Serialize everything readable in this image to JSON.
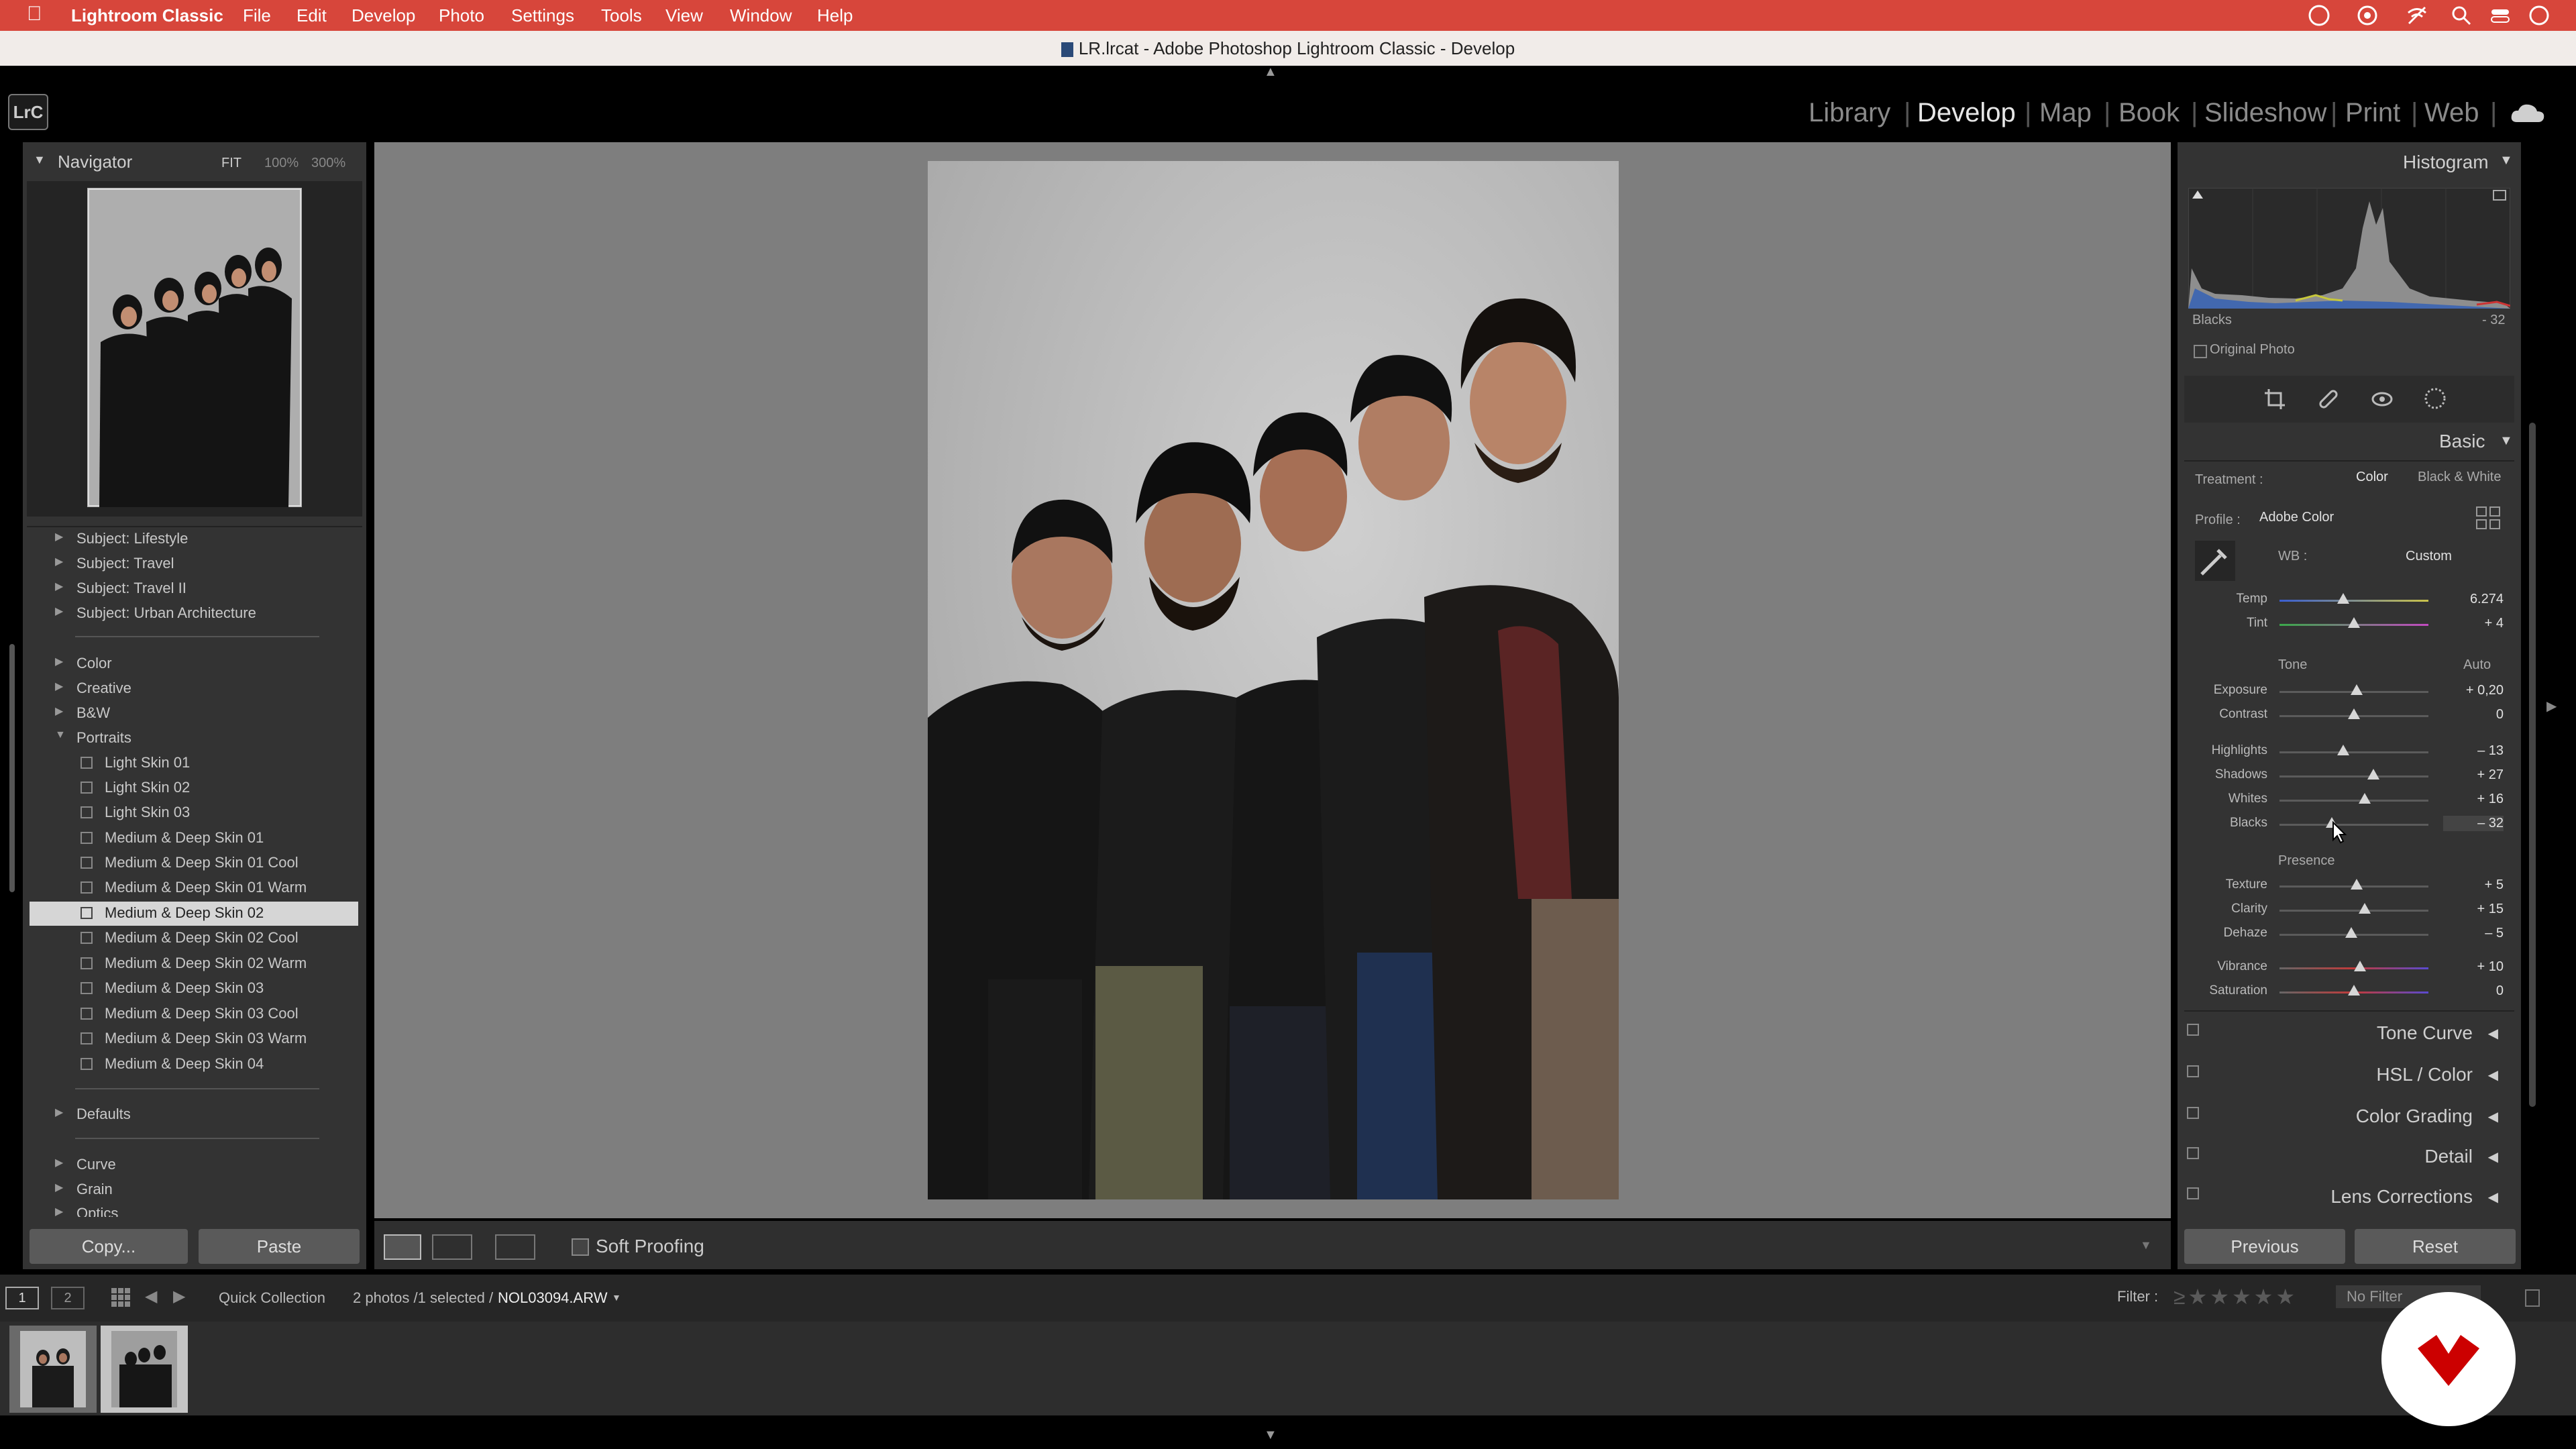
{
  "menubar": {
    "app": "Lightroom Classic",
    "items": [
      "File",
      "Edit",
      "Develop",
      "Photo",
      "Settings",
      "Tools",
      "View",
      "Window",
      "Help"
    ]
  },
  "window": {
    "title": "LR.lrcat - Adobe Photoshop Lightroom Classic - Develop"
  },
  "logo": "LrC",
  "modules": [
    "Library",
    "Develop",
    "Map",
    "Book",
    "Slideshow",
    "Print",
    "Web"
  ],
  "active_module": "Develop",
  "navigator": {
    "title": "Navigator",
    "zoom_options": [
      "FIT",
      "100%",
      "300%"
    ]
  },
  "presets": {
    "items": [
      {
        "label": "Subject: Lifestyle",
        "type": "folder"
      },
      {
        "label": "Subject: Travel",
        "type": "folder"
      },
      {
        "label": "Subject: Travel II",
        "type": "folder"
      },
      {
        "label": "Subject: Urban Architecture",
        "type": "folder"
      },
      {
        "label": "Color",
        "type": "folder"
      },
      {
        "label": "Creative",
        "type": "folder"
      },
      {
        "label": "B&W",
        "type": "folder"
      },
      {
        "label": "Portraits",
        "type": "folder-open"
      },
      {
        "label": "Light Skin 01",
        "type": "preset"
      },
      {
        "label": "Light Skin 02",
        "type": "preset"
      },
      {
        "label": "Light Skin 03",
        "type": "preset"
      },
      {
        "label": "Medium & Deep Skin 01",
        "type": "preset"
      },
      {
        "label": "Medium & Deep Skin 01 Cool",
        "type": "preset"
      },
      {
        "label": "Medium & Deep Skin 01 Warm",
        "type": "preset"
      },
      {
        "label": "Medium & Deep Skin 02",
        "type": "preset",
        "selected": true
      },
      {
        "label": "Medium & Deep Skin 02 Cool",
        "type": "preset"
      },
      {
        "label": "Medium & Deep Skin 02 Warm",
        "type": "preset"
      },
      {
        "label": "Medium & Deep Skin 03",
        "type": "preset"
      },
      {
        "label": "Medium & Deep Skin 03 Cool",
        "type": "preset"
      },
      {
        "label": "Medium & Deep Skin 03 Warm",
        "type": "preset"
      },
      {
        "label": "Medium & Deep Skin 04",
        "type": "preset"
      },
      {
        "label": "Defaults",
        "type": "folder"
      },
      {
        "label": "Curve",
        "type": "folder"
      },
      {
        "label": "Grain",
        "type": "folder"
      },
      {
        "label": "Optics",
        "type": "folder"
      }
    ]
  },
  "left_buttons": {
    "copy": "Copy...",
    "paste": "Paste"
  },
  "toolbar": {
    "soft_proofing": "Soft Proofing"
  },
  "histogram": {
    "title": "Histogram",
    "readout_label": "Blacks",
    "readout_value": "- 32",
    "original_photo": "Original Photo"
  },
  "basic": {
    "title": "Basic",
    "treatment_label": "Treatment :",
    "treatment_color": "Color",
    "treatment_bw": "Black & White",
    "profile_label": "Profile :",
    "profile_value": "Adobe Color",
    "wb_label": "WB :",
    "wb_value": "Custom",
    "tone_label": "Tone",
    "auto_label": "Auto",
    "presence_label": "Presence",
    "sliders": [
      {
        "label": "Temp",
        "value": "6.274",
        "pos": 0.43,
        "group": "wb"
      },
      {
        "label": "Tint",
        "value": "+ 4",
        "pos": 0.5,
        "group": "wb"
      },
      {
        "label": "Exposure",
        "value": "+ 0,20",
        "pos": 0.52,
        "group": "tone"
      },
      {
        "label": "Contrast",
        "value": "0",
        "pos": 0.5,
        "group": "tone"
      },
      {
        "label": "Highlights",
        "value": "– 13",
        "pos": 0.43,
        "group": "tone"
      },
      {
        "label": "Shadows",
        "value": "+ 27",
        "pos": 0.63,
        "group": "tone"
      },
      {
        "label": "Whites",
        "value": "+ 16",
        "pos": 0.57,
        "group": "tone"
      },
      {
        "label": "Blacks",
        "value": "– 32",
        "pos": 0.35,
        "group": "tone"
      },
      {
        "label": "Texture",
        "value": "+ 5",
        "pos": 0.52,
        "group": "presence"
      },
      {
        "label": "Clarity",
        "value": "+ 15",
        "pos": 0.57,
        "group": "presence"
      },
      {
        "label": "Dehaze",
        "value": "– 5",
        "pos": 0.48,
        "group": "presence"
      },
      {
        "label": "Vibrance",
        "value": "+ 10",
        "pos": 0.54,
        "group": "presence"
      },
      {
        "label": "Saturation",
        "value": "0",
        "pos": 0.5,
        "group": "presence"
      }
    ]
  },
  "sections": [
    "Tone Curve",
    "HSL / Color",
    "Color Grading",
    "Detail",
    "Lens Corrections"
  ],
  "right_buttons": {
    "previous": "Previous",
    "reset": "Reset"
  },
  "filmstrip": {
    "pages": [
      "1",
      "2"
    ],
    "source": "Quick Collection",
    "info": "2 photos /1 selected /",
    "filename": "NOL03094.ARW",
    "filter_label": "Filter :",
    "filter_value": "No Filter"
  },
  "colors": {
    "menubar": "#d7463b",
    "panel": "#333333",
    "accent": "#cc0000"
  }
}
